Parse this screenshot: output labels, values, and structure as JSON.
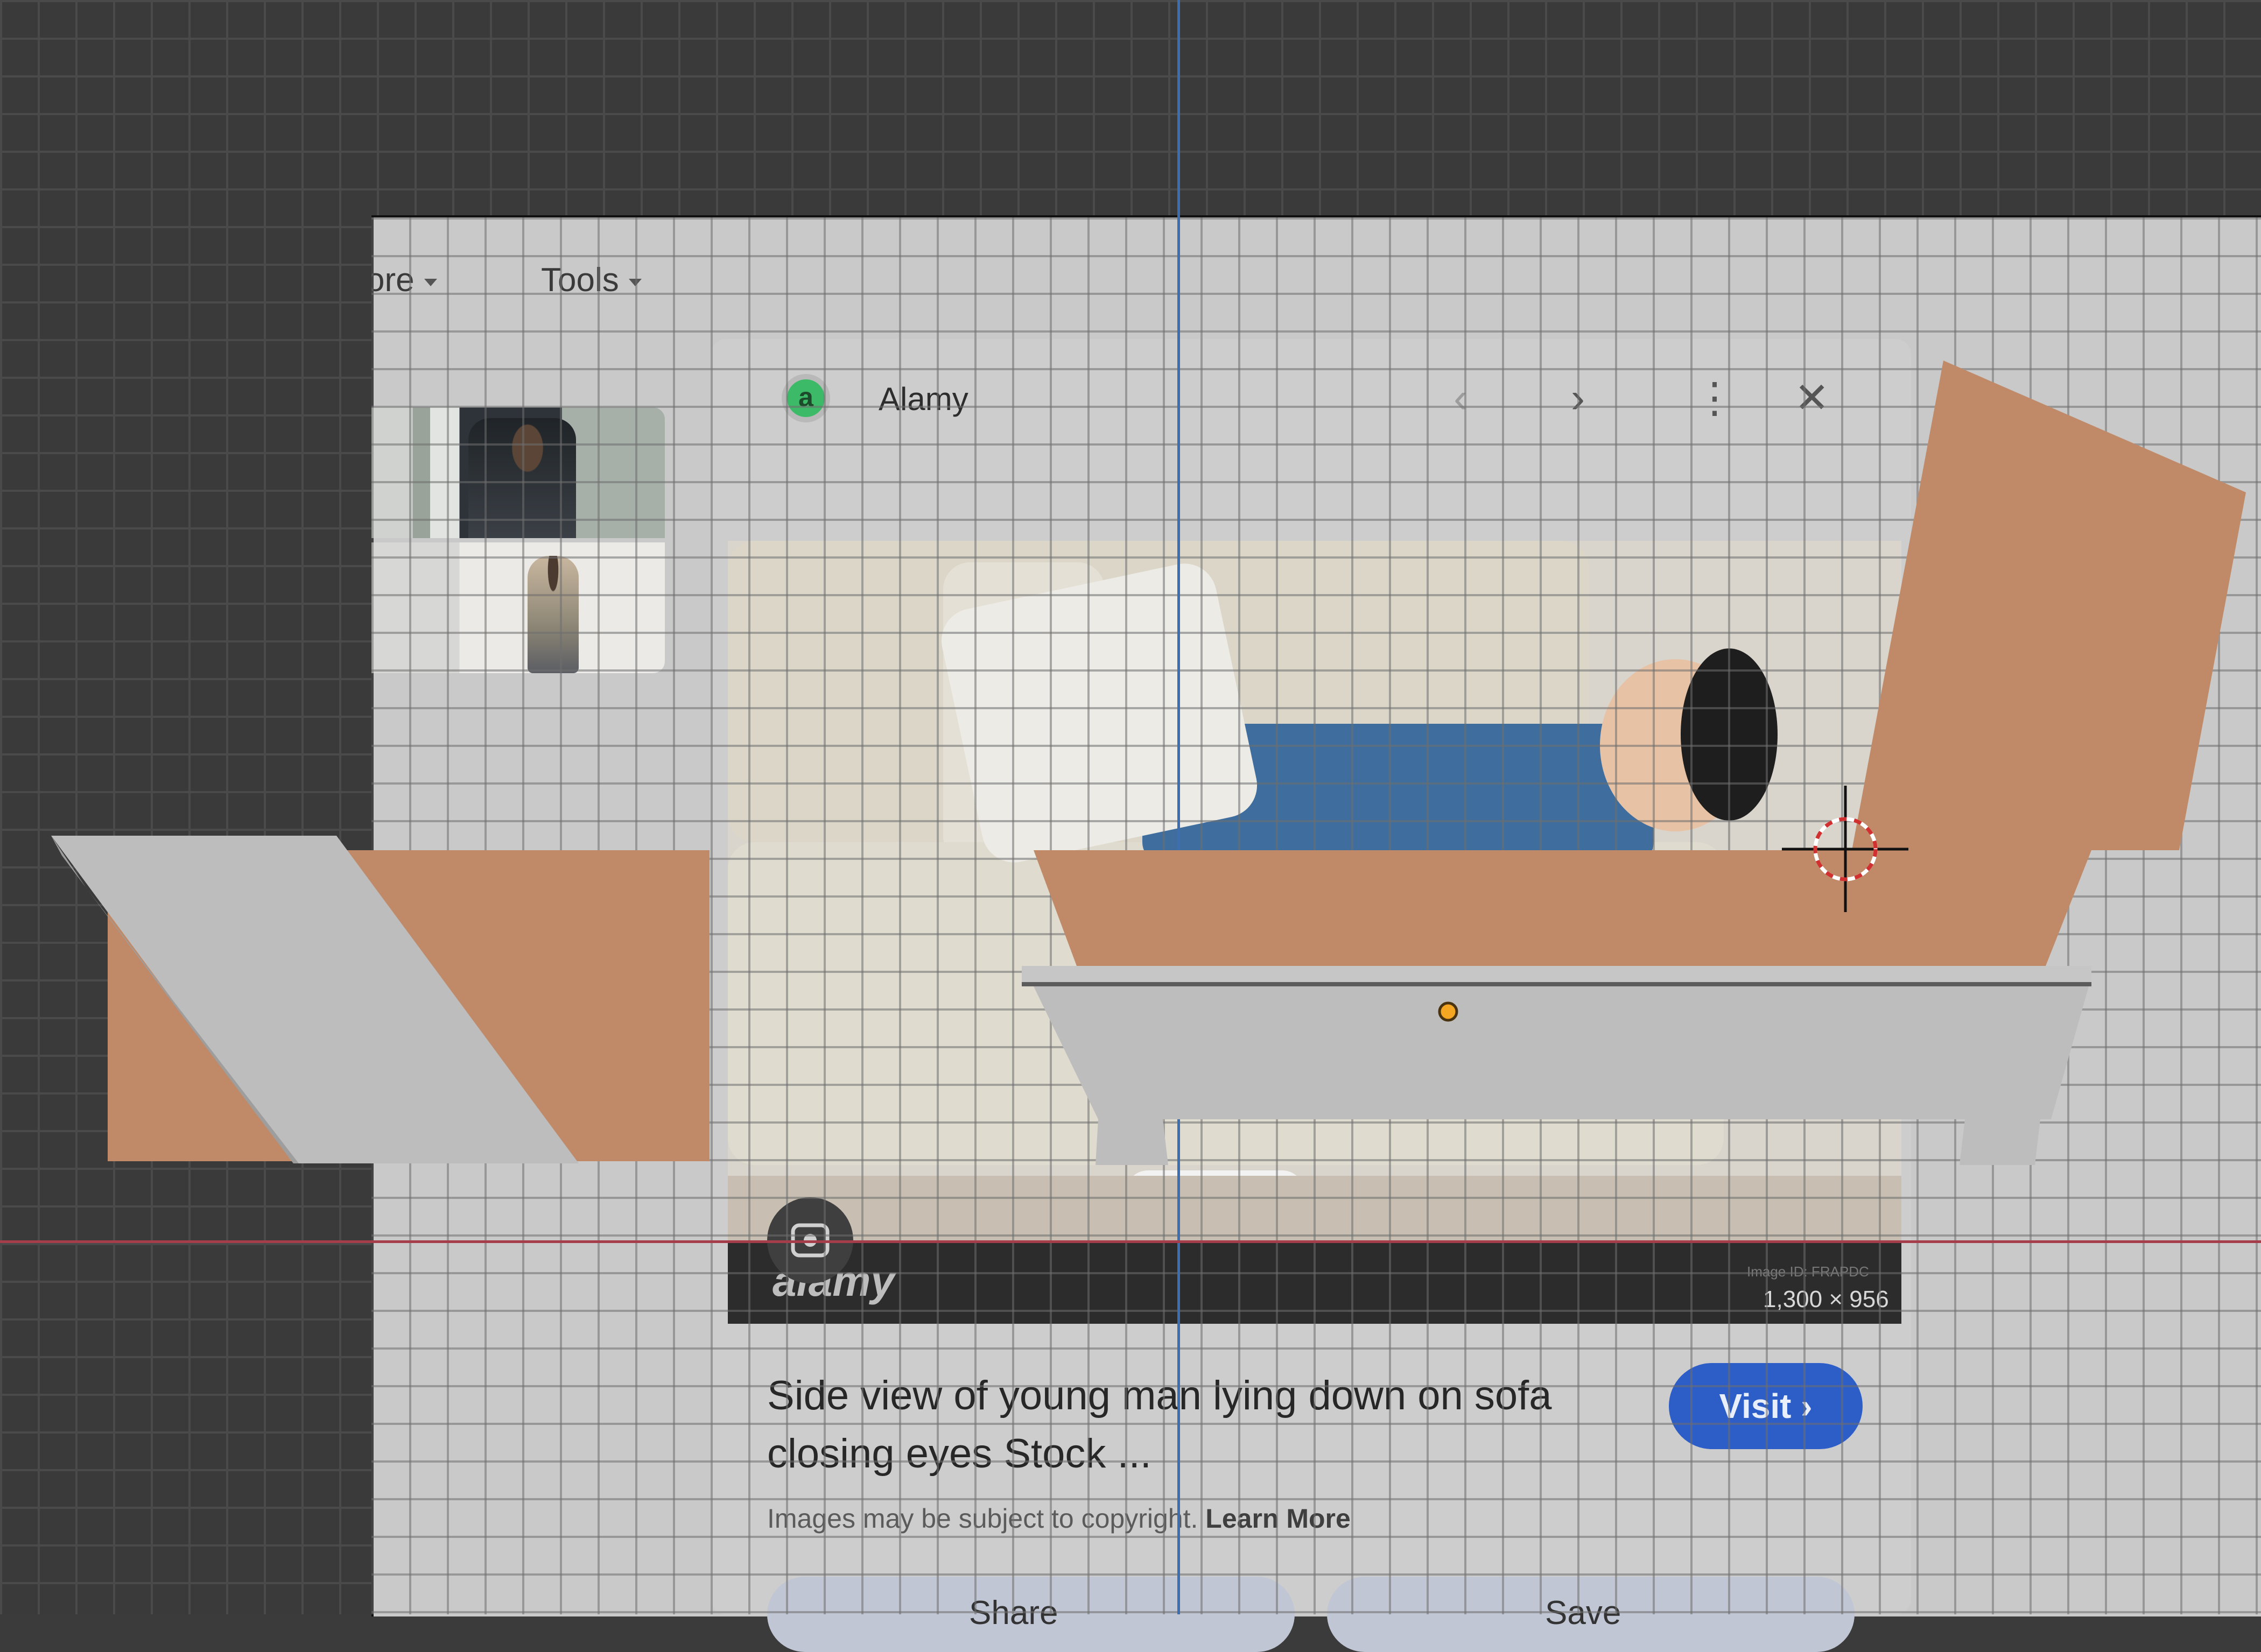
{
  "menu": {
    "more_label": "More",
    "more_visible": "ore",
    "tools_label": "Tools"
  },
  "card": {
    "source_initial": "a",
    "source_name": "Alamy",
    "controls": {
      "prev": "‹",
      "next": "›",
      "more": "⋮",
      "close": "✕"
    },
    "watermark": "alamy",
    "image_id": "Image ID: FRAPDC",
    "dimensions": "1,300 × 956",
    "title": "Side view of young man lying down on sofa closing eyes Stock ...",
    "visit_label": "Visit",
    "copyright_text": "Images may be subject to copyright.",
    "learn_more_label": "Learn More",
    "share_label": "Share",
    "save_label": "Save"
  },
  "icons": {
    "lens": "lens-icon",
    "share": "share-icon",
    "save": "bookmark-icon"
  },
  "colors": {
    "viewport_bg": "#3a3a3a",
    "shape_orange": "#c08a68",
    "shape_gray": "#bdbdbd",
    "guide_vertical": "#3d6fb0",
    "guide_horizontal": "#a53d4a",
    "visit_button": "#2d5ec8",
    "origin_point": "#f5a623"
  }
}
